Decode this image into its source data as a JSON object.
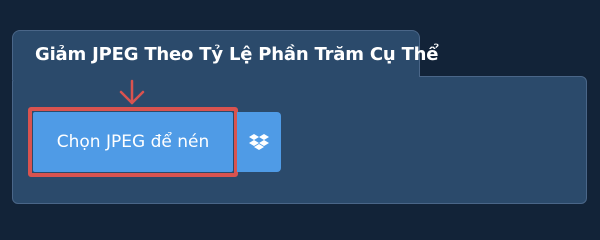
{
  "panel": {
    "title": "Giảm JPEG Theo Tỷ Lệ Phần Trăm Cụ Thể"
  },
  "upload": {
    "button_label": "Chọn JPEG để nén"
  },
  "icons": {
    "pointer": "arrow-down-icon",
    "cloud": "dropbox-icon"
  },
  "colors": {
    "background": "#122338",
    "panel": "#2b4a6b",
    "button": "#4f9be6",
    "highlight": "#d9534f"
  }
}
